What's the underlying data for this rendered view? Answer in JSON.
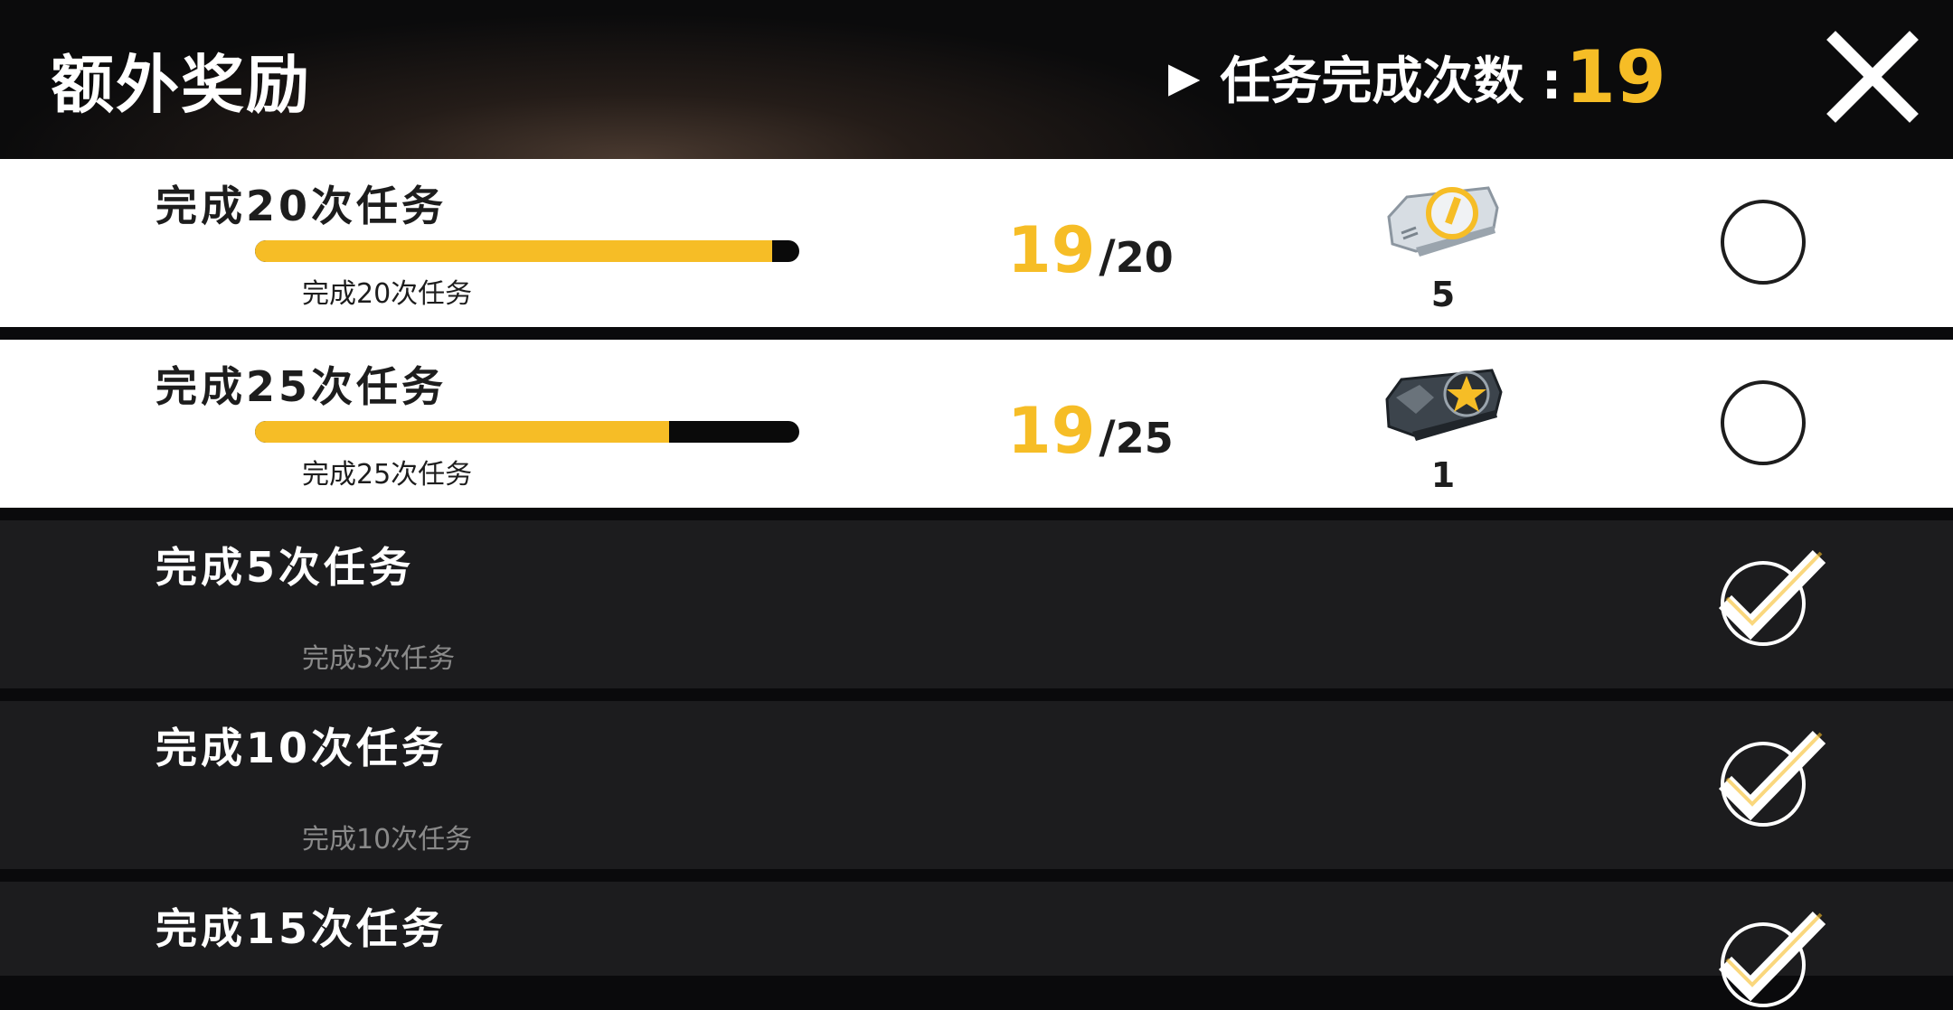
{
  "header": {
    "title": "额外奖励",
    "counter_arrow": "▶",
    "counter_label": "任务完成次数 :",
    "counter_value": "19",
    "close_icon": "close-icon"
  },
  "colors": {
    "accent": "#f6bd26",
    "active_row_bg": "#ffffff",
    "done_row_bg": "#1c1c1e"
  },
  "rows": [
    {
      "title": "完成20次任务",
      "subtitle": "完成20次任务",
      "state": "active",
      "progress_current": "19",
      "progress_sep": "/",
      "progress_total": "20",
      "progress_fraction": 0.95,
      "reward_icon": "ticket-icon",
      "reward_count": "5",
      "status_icon": "empty-circle-icon"
    },
    {
      "title": "完成25次任务",
      "subtitle": "完成25次任务",
      "state": "active",
      "progress_current": "19",
      "progress_sep": "/",
      "progress_total": "25",
      "progress_fraction": 0.76,
      "reward_icon": "star-card-icon",
      "reward_count": "1",
      "status_icon": "empty-circle-icon"
    },
    {
      "title": "完成5次任务",
      "subtitle": "完成5次任务",
      "state": "done",
      "status_icon": "check-circle-icon"
    },
    {
      "title": "完成10次任务",
      "subtitle": "完成10次任务",
      "state": "done",
      "status_icon": "check-circle-icon"
    },
    {
      "title": "完成15次任务",
      "state": "done",
      "status_icon": "check-circle-icon"
    }
  ]
}
